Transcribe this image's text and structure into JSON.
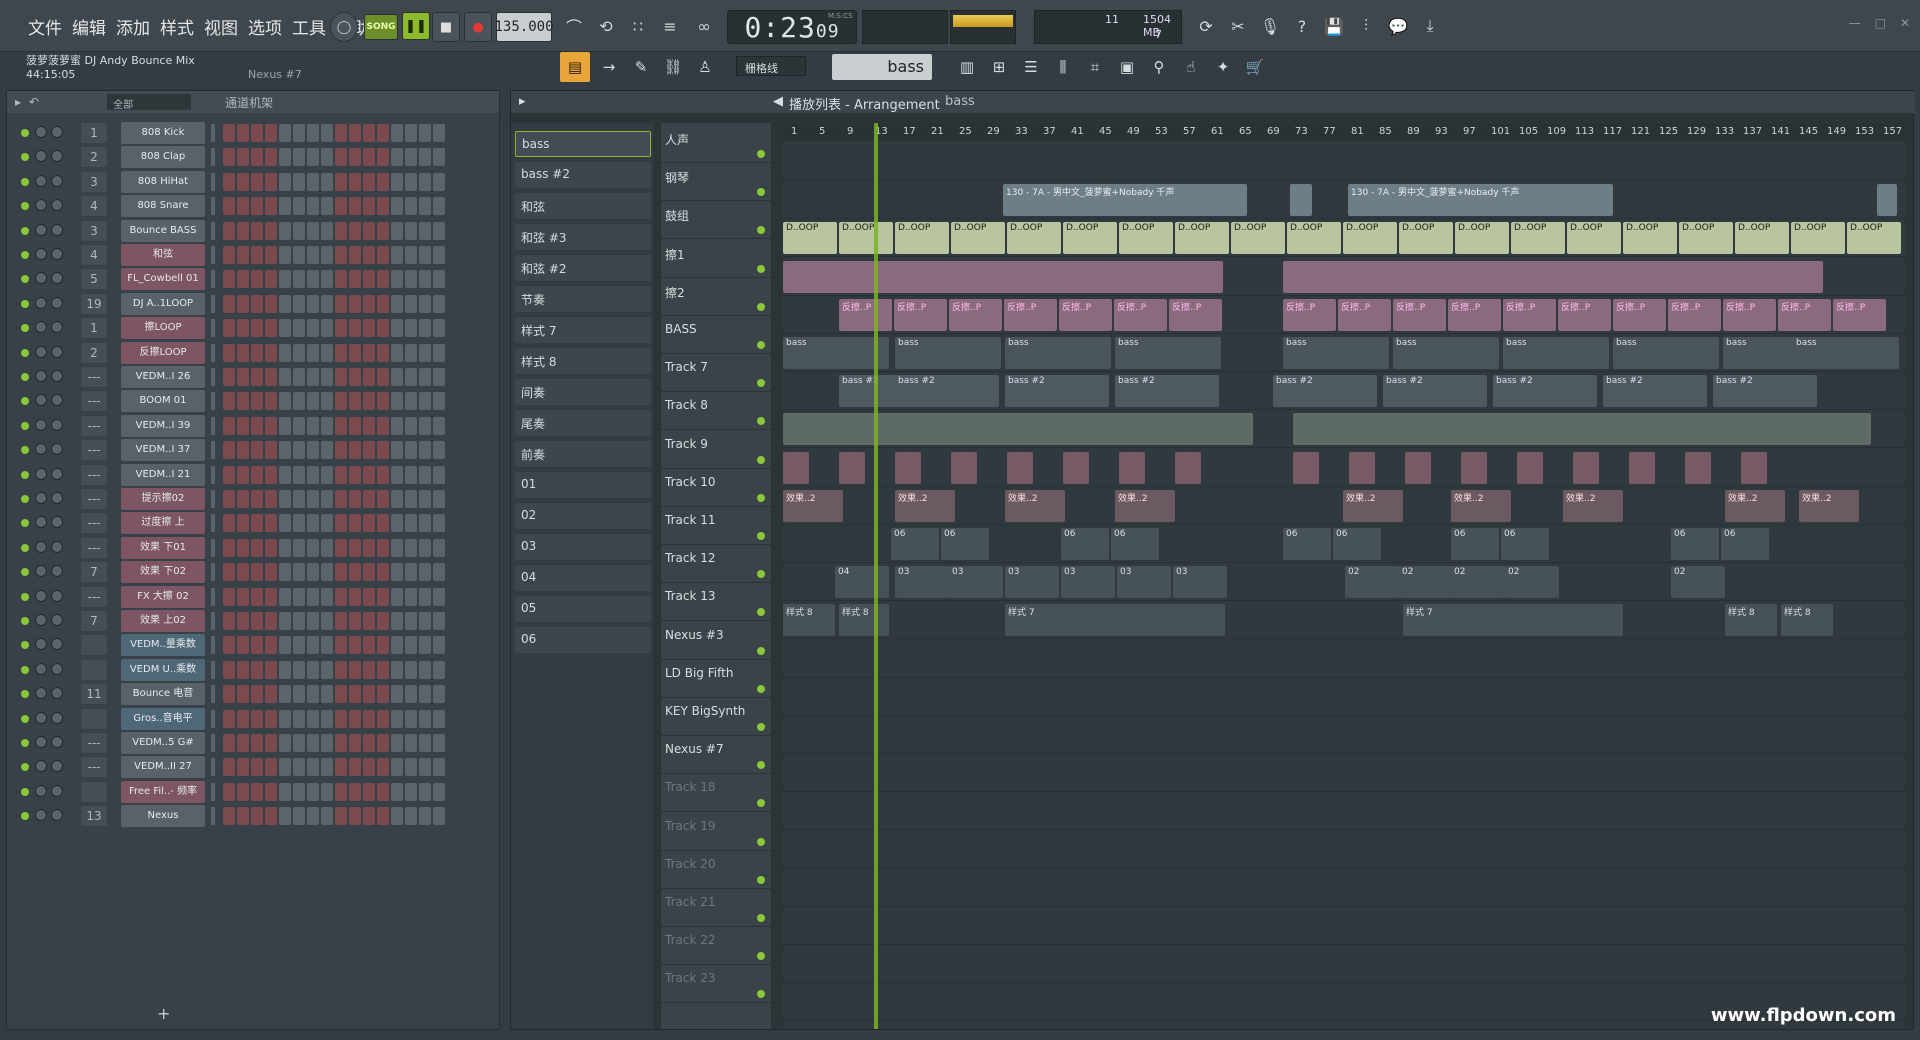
{
  "menu": [
    "文件",
    "编辑",
    "添加",
    "样式",
    "视图",
    "选项",
    "工具",
    "帮助"
  ],
  "transport": {
    "mode": "SONG",
    "tempo": "135.000",
    "time": "0:23",
    "time_ms": "09",
    "time_unit": "M:S:CS"
  },
  "monitor": {
    "mem_label": "1504 MB",
    "voices": "11",
    "cpu_val": "7"
  },
  "hint": {
    "line1": "菠萝菠萝蜜 DJ Andy Bounce Mix",
    "line2": "44:15:05",
    "line3": "Nexus #7"
  },
  "toolbar2": {
    "snap": "栅格线",
    "pattern": "bass"
  },
  "rack": {
    "title": "通道机架",
    "filter": "全部",
    "add": "+",
    "channels": [
      {
        "num": "1",
        "name": "808 Kick",
        "style": "grey"
      },
      {
        "num": "2",
        "name": "808 Clap",
        "style": "grey"
      },
      {
        "num": "3",
        "name": "808 HiHat",
        "style": "grey"
      },
      {
        "num": "4",
        "name": "808 Snare",
        "style": "grey"
      },
      {
        "num": "3",
        "name": "Bounce BASS",
        "style": "grey"
      },
      {
        "num": "4",
        "name": "和弦",
        "style": "pink"
      },
      {
        "num": "5",
        "name": "FL_Cowbell 01",
        "style": "pink"
      },
      {
        "num": "19",
        "name": "DJ A..1LOOP",
        "style": "grey"
      },
      {
        "num": "1",
        "name": "擦LOOP",
        "style": "pink"
      },
      {
        "num": "2",
        "name": "反擦LOOP",
        "style": "pink"
      },
      {
        "num": "---",
        "name": "VEDM..I 26",
        "style": "grey"
      },
      {
        "num": "---",
        "name": "BOOM 01",
        "style": "grey"
      },
      {
        "num": "---",
        "name": "VEDM..I 39",
        "style": "grey"
      },
      {
        "num": "---",
        "name": "VEDM..I 37",
        "style": "grey"
      },
      {
        "num": "---",
        "name": "VEDM..I 21",
        "style": "grey"
      },
      {
        "num": "---",
        "name": "提示擦02",
        "style": "pink"
      },
      {
        "num": "---",
        "name": "过度擦 上",
        "style": "pink"
      },
      {
        "num": "---",
        "name": "效果 下01",
        "style": "pink"
      },
      {
        "num": "7",
        "name": "效果 下02",
        "style": "pink"
      },
      {
        "num": "---",
        "name": "FX 大擦 02",
        "style": "pink"
      },
      {
        "num": "7",
        "name": "效果 上02",
        "style": "pink"
      },
      {
        "num": "",
        "name": "VEDM..量乘数",
        "style": "blue"
      },
      {
        "num": "",
        "name": "VEDM U..乘数",
        "style": "blue"
      },
      {
        "num": "11",
        "name": "Bounce 电音",
        "style": "grey"
      },
      {
        "num": "",
        "name": "Gros..音电平",
        "style": "blue"
      },
      {
        "num": "---",
        "name": "VEDM..5 G#",
        "style": "grey"
      },
      {
        "num": "---",
        "name": "VEDM..II 27",
        "style": "grey"
      },
      {
        "num": "",
        "name": "Free Fil..- 频率",
        "style": "pink"
      },
      {
        "num": "13",
        "name": "Nexus",
        "style": "grey"
      }
    ]
  },
  "playlist": {
    "title": "播放列表 - Arrangement",
    "crumb": "bass",
    "patterns": [
      "bass",
      "bass #2",
      "和弦",
      "和弦 #3",
      "和弦 #2",
      "节奏",
      "样式 7",
      "样式 8",
      "间奏",
      "尾奏",
      "前奏",
      "01",
      "02",
      "03",
      "04",
      "05",
      "06"
    ],
    "tracks": [
      "人声",
      "钢琴",
      "鼓组",
      "擦1",
      "擦2",
      "BASS",
      "Track 7",
      "Track 8",
      "Track 9",
      "Track 10",
      "Track 11",
      "Track 12",
      "Track 13",
      "Nexus #3",
      "LD Big Fifth",
      "KEY BigSynth",
      "Nexus #7",
      "Track 18",
      "Track 19",
      "Track 20",
      "Track 21",
      "Track 22",
      "Track 23"
    ],
    "ruler": [
      "1",
      "5",
      "9",
      "13",
      "17",
      "21",
      "25",
      "29",
      "33",
      "37",
      "41",
      "45",
      "49",
      "53",
      "57",
      "61",
      "65",
      "69",
      "73",
      "77",
      "81",
      "85",
      "89",
      "93",
      "97",
      "101",
      "105",
      "109",
      "113",
      "117",
      "121",
      "125",
      "129",
      "133",
      "137",
      "141",
      "145",
      "149",
      "153",
      "157"
    ],
    "clips": {
      "piano": "130 - 7A - 男中文_菠萝蜜+Nobady 千声",
      "drum": "D..OOP",
      "rub": "反擦..P",
      "bass": "bass",
      "bass2": "bass #2",
      "fx": "效果..2",
      "style7": "样式 7",
      "style8": "样式 8",
      "p01": "01",
      "p02": "02",
      "p03": "03",
      "p04": "04",
      "p06": "06"
    }
  },
  "watermark": "www.flpdown.com"
}
